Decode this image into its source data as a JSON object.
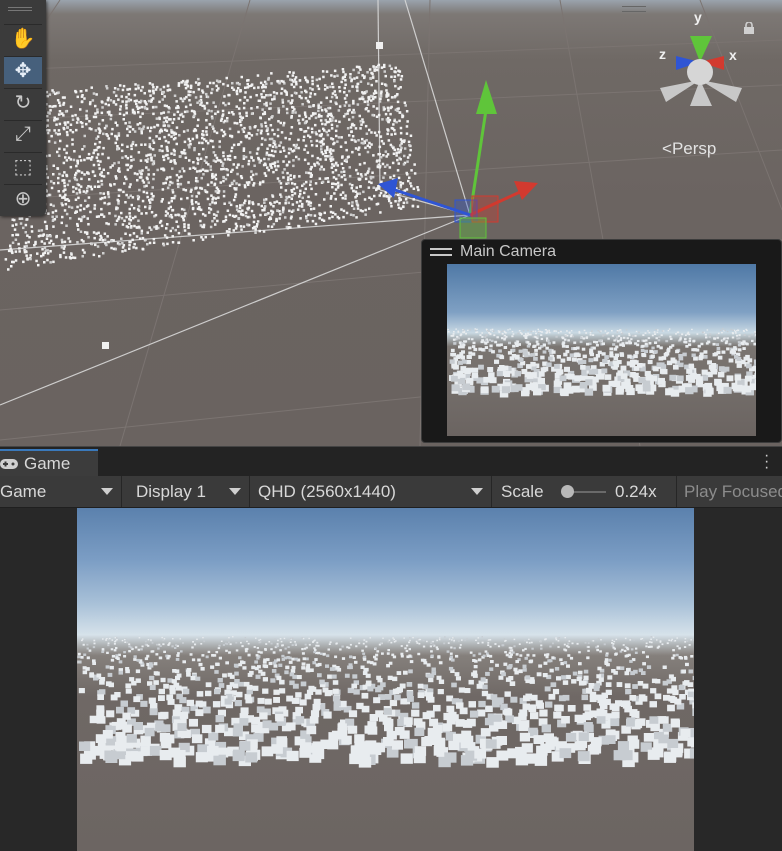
{
  "scene": {
    "persp_label": "Persp",
    "gizmo_axes": {
      "y": "y",
      "x": "x",
      "z": "z"
    },
    "tools": [
      {
        "name": "hand-tool",
        "icon": "hand-icon",
        "active": false
      },
      {
        "name": "move-tool",
        "icon": "move-icon",
        "active": true
      },
      {
        "name": "rotate-tool",
        "icon": "rotate-icon",
        "active": false
      },
      {
        "name": "scale-tool",
        "icon": "scale-icon",
        "active": false
      },
      {
        "name": "rect-tool",
        "icon": "rect-tool-icon",
        "active": false
      },
      {
        "name": "transform-tool",
        "icon": "transform-icon",
        "active": false
      }
    ],
    "camera_preview": {
      "title": "Main Camera"
    }
  },
  "game": {
    "tab_label": "Game",
    "view_mode": "Game",
    "display": "Display 1",
    "resolution": "QHD (2560x1440)",
    "scale_label": "Scale",
    "scale_value": "0.24x",
    "play_focused": "Play Focused"
  },
  "colors": {
    "accent": "#3a79bb",
    "axis_x": "#d23a2f",
    "axis_y": "#5fc53a",
    "axis_z": "#2f55d4",
    "ground": "#6b6461"
  }
}
